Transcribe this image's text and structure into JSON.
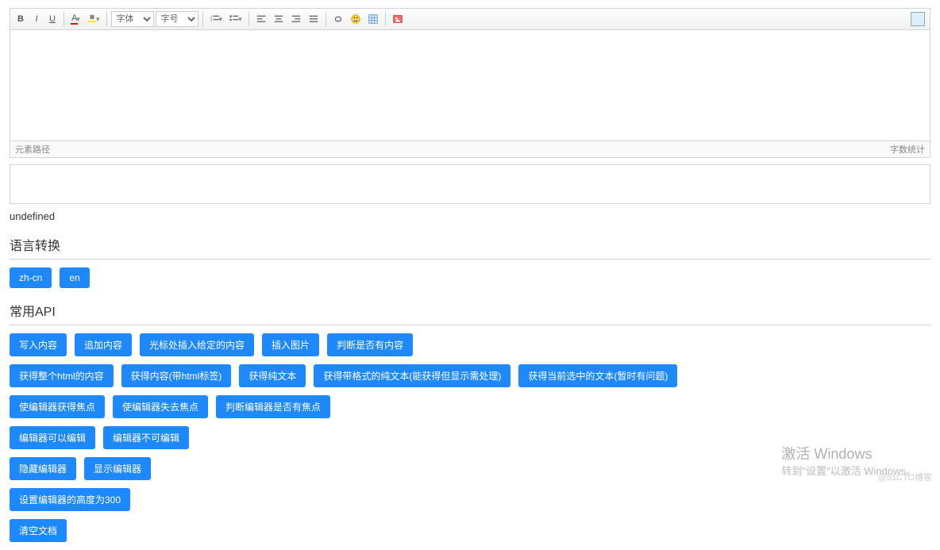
{
  "toolbar": {
    "bold": "B",
    "italic": "I",
    "underline": "U",
    "font_color": "A",
    "font_label": "字体",
    "size_label": "字号"
  },
  "statusbar": {
    "path_label": "元素路径",
    "wordcount_label": "字数统计"
  },
  "undefined_text": "undefined",
  "section_lang": "语言转换",
  "lang_buttons": [
    "zh-cn",
    "en"
  ],
  "section_api": "常用API",
  "api_rows": [
    [
      "写入内容",
      "追加内容",
      "光标处插入给定的内容",
      "插入图片",
      "判断是否有内容"
    ],
    [
      "获得整个html的内容",
      "获得内容(带html标签)",
      "获得纯文本",
      "获得带格式的纯文本(能获得但显示需处理)",
      "获得当前选中的文本(暂时有问题)"
    ],
    [
      "使编辑器获得焦点",
      "使编辑器失去焦点",
      "判断编辑器是否有焦点"
    ],
    [
      "编辑器可以编辑",
      "编辑器不可编辑"
    ],
    [
      "隐藏编辑器",
      "显示编辑器"
    ],
    [
      "设置编辑器的高度为300"
    ],
    [
      "清空文档"
    ]
  ],
  "watermark": {
    "line1": "激活 Windows",
    "line2": "转到\"设置\"以激活 Windows。"
  },
  "blog_tag": "@51CTO博客"
}
